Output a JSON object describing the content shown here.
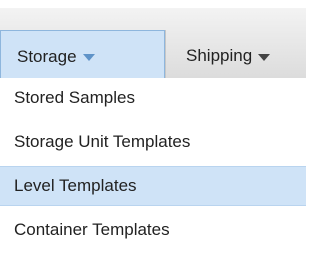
{
  "menubar": {
    "items": [
      {
        "label": "Storage",
        "active": true
      },
      {
        "label": "Shipping",
        "active": false
      }
    ]
  },
  "dropdown": {
    "items": [
      {
        "label": "Stored Samples",
        "highlighted": false
      },
      {
        "label": "Storage Unit Templates",
        "highlighted": false
      },
      {
        "label": "Level Templates",
        "highlighted": true
      },
      {
        "label": "Container Templates",
        "highlighted": false
      }
    ]
  },
  "colors": {
    "menubar_bg": "#e6e6e6",
    "active_bg": "#cfe3f7",
    "active_border": "#8eb6dd",
    "caret_active": "#5f93c8"
  }
}
